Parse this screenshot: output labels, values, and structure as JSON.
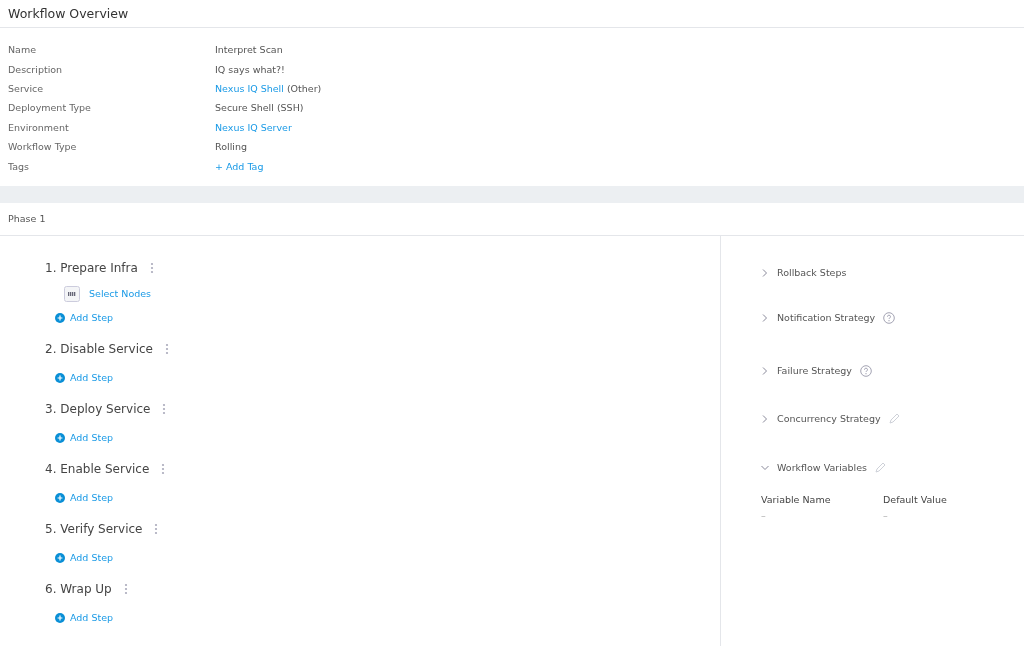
{
  "header": {
    "title": "Workflow Overview"
  },
  "details": [
    {
      "label": "Name",
      "value": [
        {
          "kind": "text",
          "text": "Interpret Scan"
        }
      ]
    },
    {
      "label": "Description",
      "value": [
        {
          "kind": "text",
          "text": "IQ says what?!"
        }
      ]
    },
    {
      "label": "Service",
      "value": [
        {
          "kind": "link",
          "text": "Nexus IQ Shell"
        },
        {
          "kind": "text",
          "text": "(Other)"
        }
      ]
    },
    {
      "label": "Deployment Type",
      "value": [
        {
          "kind": "text",
          "text": "Secure Shell (SSH)"
        }
      ]
    },
    {
      "label": "Environment",
      "value": [
        {
          "kind": "link",
          "text": "Nexus IQ Server"
        }
      ]
    },
    {
      "label": "Workflow Type",
      "value": [
        {
          "kind": "text",
          "text": "Rolling"
        }
      ]
    },
    {
      "label": "Tags",
      "value": [
        {
          "kind": "link",
          "text": "+ Add Tag"
        }
      ]
    }
  ],
  "phase": {
    "title": "Phase 1"
  },
  "steps": [
    {
      "title": "1. Prepare Infra",
      "nodes": "Select Nodes",
      "add": "Add Step"
    },
    {
      "title": "2. Disable Service",
      "add": "Add Step"
    },
    {
      "title": "3. Deploy Service",
      "add": "Add Step"
    },
    {
      "title": "4. Enable Service",
      "add": "Add Step"
    },
    {
      "title": "5. Verify Service",
      "add": "Add Step"
    },
    {
      "title": "6. Wrap Up",
      "add": "Add Step"
    }
  ],
  "sections": [
    {
      "title": "Rollback Steps",
      "expanded": false,
      "kind": "plain"
    },
    {
      "title": "Notification Strategy",
      "expanded": false,
      "kind": "help"
    },
    {
      "title": "Failure Strategy",
      "expanded": false,
      "kind": "help"
    },
    {
      "title": "Concurrency Strategy",
      "expanded": false,
      "kind": "editable"
    },
    {
      "title": "Workflow Variables",
      "expanded": true,
      "kind": "editable"
    }
  ],
  "variables": {
    "columns": [
      "Variable Name",
      "Default Value"
    ],
    "rows": [
      [
        "–",
        "–"
      ]
    ]
  }
}
